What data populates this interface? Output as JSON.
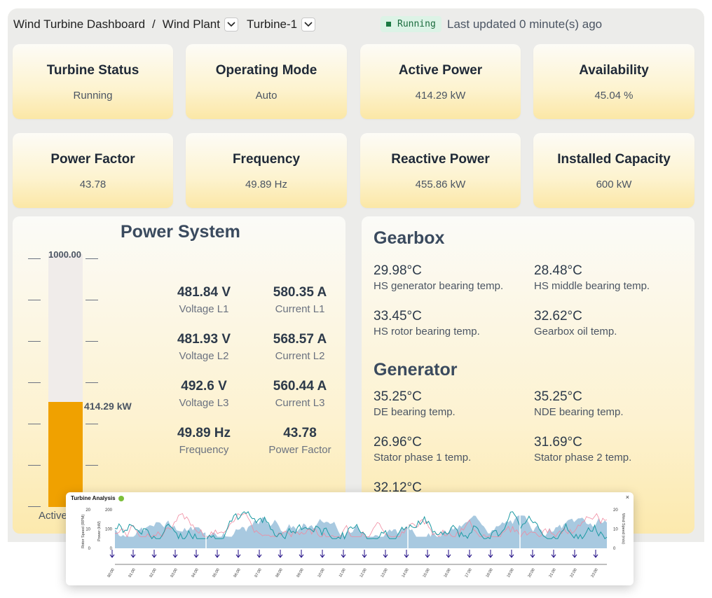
{
  "header": {
    "breadcrumb_root": "Wind Turbine Dashboard",
    "separator": "/",
    "plant": "Wind Plant",
    "turbine": "Turbine-1",
    "status": "Running",
    "last_updated": "Last updated 0 minute(s) ago"
  },
  "kpis": [
    {
      "title": "Turbine Status",
      "value": "Running"
    },
    {
      "title": "Operating Mode",
      "value": "Auto"
    },
    {
      "title": "Active Power",
      "value": "414.29 kW"
    },
    {
      "title": "Availability",
      "value": "45.04 %"
    },
    {
      "title": "Power Factor",
      "value": "43.78"
    },
    {
      "title": "Frequency",
      "value": "49.89 Hz"
    },
    {
      "title": "Reactive Power",
      "value": "455.86 kW"
    },
    {
      "title": "Installed Capacity",
      "value": "600 kW"
    }
  ],
  "power_system": {
    "title": "Power System",
    "gauge": {
      "max_label": "1000.00",
      "current_label": "414.29 kW",
      "max": 1000,
      "value": 414.29,
      "label": "Active"
    },
    "metrics": [
      {
        "value": "481.84 V",
        "label": "Voltage L1"
      },
      {
        "value": "580.35 A",
        "label": "Current L1"
      },
      {
        "value": "481.93 V",
        "label": "Voltage L2"
      },
      {
        "value": "568.57 A",
        "label": "Current L2"
      },
      {
        "value": "492.6 V",
        "label": "Voltage L3"
      },
      {
        "value": "560.44 A",
        "label": "Current L3"
      },
      {
        "value": "49.89 Hz",
        "label": "Frequency"
      },
      {
        "value": "43.78",
        "label": "Power Factor"
      }
    ]
  },
  "gearbox": {
    "title": "Gearbox",
    "temps": [
      {
        "value": "29.98°C",
        "label": "HS generator bearing temp."
      },
      {
        "value": "28.48°C",
        "label": "HS middle bearing temp."
      },
      {
        "value": "33.45°C",
        "label": "HS rotor bearing temp."
      },
      {
        "value": "32.62°C",
        "label": "Gearbox oil temp."
      }
    ]
  },
  "generator": {
    "title": "Generator",
    "temps": [
      {
        "value": "35.25°C",
        "label": "DE bearing temp."
      },
      {
        "value": "35.25°C",
        "label": "NDE bearing temp."
      },
      {
        "value": "26.96°C",
        "label": "Stator phase 1 temp."
      },
      {
        "value": "31.69°C",
        "label": "Stator phase 2 temp."
      },
      {
        "value": "32.12°C",
        "label": ""
      }
    ]
  },
  "analysis": {
    "title": "Turbine Analysis",
    "close": "×",
    "left_axis_labels": [
      "Rotor Speed (RPM)",
      "Power (kW)"
    ],
    "right_axis_label": "Wind Speed (m/s)",
    "left_ticks": [
      "20",
      "10",
      "0"
    ],
    "power_ticks": [
      "200",
      "100",
      "0"
    ],
    "right_ticks": [
      "20",
      "10",
      "0"
    ],
    "hours": [
      "00:00",
      "01:00",
      "02:00",
      "03:00",
      "04:00",
      "05:00",
      "06:00",
      "07:00",
      "08:00",
      "09:00",
      "10:00",
      "11:00",
      "12:00",
      "13:00",
      "14:00",
      "15:00",
      "16:00",
      "17:00",
      "18:00",
      "19:00",
      "20:00",
      "21:00",
      "22:00",
      "23:00"
    ],
    "colors": {
      "area": "#9ec3dd",
      "wind": "#1c9aa3",
      "rotor": "#f08aa0",
      "arrow": "#2d1b8c"
    }
  }
}
